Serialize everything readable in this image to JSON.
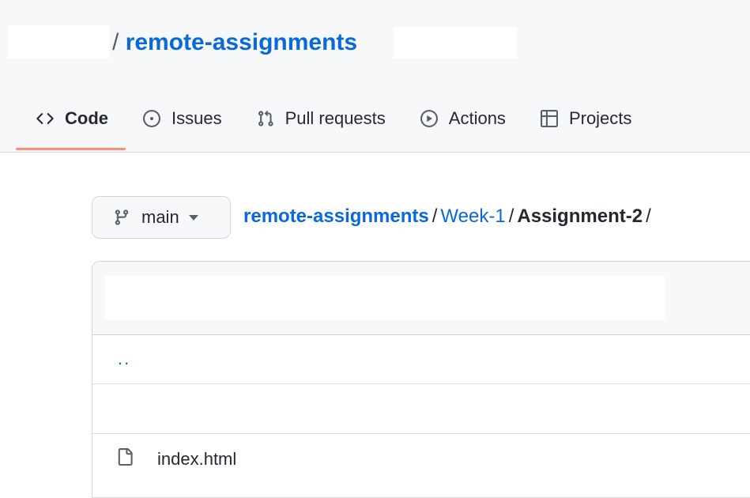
{
  "repo": {
    "slash": "/",
    "name": "remote-assignments"
  },
  "tabs": [
    {
      "label": "Code",
      "icon": "code-icon",
      "selected": true
    },
    {
      "label": "Issues",
      "icon": "issue-opened-icon"
    },
    {
      "label": "Pull requests",
      "icon": "git-pull-request-icon"
    },
    {
      "label": "Actions",
      "icon": "play-icon"
    },
    {
      "label": "Projects",
      "icon": "table-icon"
    }
  ],
  "branch": {
    "label": "main",
    "icon": "git-branch-icon"
  },
  "breadcrumb": {
    "root": "remote-assignments",
    "sep1": "/",
    "folder": "Week-1",
    "sep2": "/",
    "current": "Assignment-2",
    "sep3": "/"
  },
  "file_list": {
    "up_label": "..",
    "files": [
      {
        "name": "index.html",
        "icon": "file-icon"
      }
    ]
  },
  "colors": {
    "link": "#0969da",
    "text": "#24292f",
    "tab_underline": "#fd8c73",
    "border": "#d0d7de",
    "header_bg": "#f6f8fa"
  }
}
